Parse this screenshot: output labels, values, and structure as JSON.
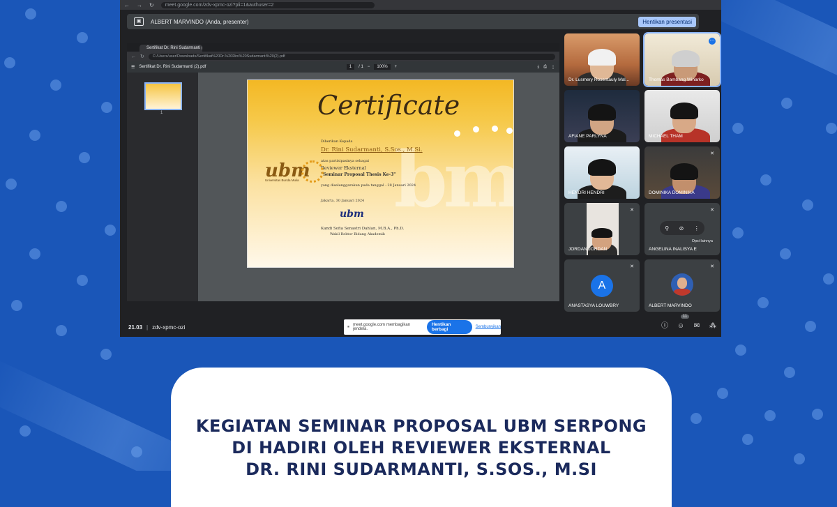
{
  "browser": {
    "url": "meet.google.com/zdv-xpmc-ozi?pli=1&authuser=2"
  },
  "presentation_bar": {
    "presenter": "ALBERT MARVINDO (Anda, presenter)",
    "stop_label": "Hentikan presentasi"
  },
  "shared_window": {
    "tab_title": "Sertifikat Dr. Rini Sudarmanti (",
    "url": "C:/Users/user/Downloads/Sertifikat%20Dr.%20Rini%20Sudarmanti%20(2).pdf",
    "file_name": "Sertifikat Dr. Rini Sudarmanti (2).pdf",
    "page": "1",
    "page_total": "/ 1",
    "zoom": "100%",
    "thumb_number": "1"
  },
  "certificate": {
    "title": "Certificate",
    "given_to_label": "Diberikan Kepada",
    "recipient": "Dr. Rini Sudarmanti, S.Sos., M.Si.",
    "participation_label": "atas partisipasinya sebagai",
    "role": "Reviewer Eksternal",
    "event": "\"Seminar Proposal Thesis Ke-3\"",
    "date_line": "yang diselenggarakan pada tanggal : 28 Januari 2024",
    "place_date": "Jakarta, 30 Januari 2024",
    "logo_text": "ubm",
    "logo_subtitle": "Universitas Bunda Mulia",
    "signer": "Kandi Sofia Senastri Dahlan, M.B.A., Ph.D.",
    "signer_title": "Wakil Rektor Bidang Akademik"
  },
  "participants": [
    {
      "name": "Dr. Lusmery Rosentauly Mal..."
    },
    {
      "name": "Thomas Bambang Winarko"
    },
    {
      "name": "AFIANE PARLYNA"
    },
    {
      "name": "MICHAEL THAM"
    },
    {
      "name": "HENDRI HENDRI"
    },
    {
      "name": "DOMINIKA DOMINIKA"
    },
    {
      "name": "JORDAN JORDAN"
    },
    {
      "name": "ANGELINA INALISYA E",
      "menu_label": "Opsi lainnya"
    },
    {
      "name": "ANASTASYA LOUWBRY",
      "initial": "A"
    },
    {
      "name": "ALBERT MARVINDO"
    }
  ],
  "bottom_bar": {
    "time": "21.03",
    "separator": "|",
    "meeting_code": "zdv-xpmc-ozi",
    "participant_count": "11"
  },
  "share_notice": {
    "text": "meet.google.com membagikan jendela.",
    "stop_label": "Hentikan berbagi",
    "hide_label": "Sembunyikan"
  },
  "caption": {
    "line1": "KEGIATAN SEMINAR PROPOSAL UBM SERPONG",
    "line2": "DI HADIRI OLEH REVIEWER EKSTERNAL",
    "line3": "DR. RINI SUDARMANTI, S.SOS., M.SI"
  },
  "colors": {
    "background": "#1a56b8",
    "caption_text": "#1b2a5c",
    "accent_blue": "#1a73e8"
  }
}
